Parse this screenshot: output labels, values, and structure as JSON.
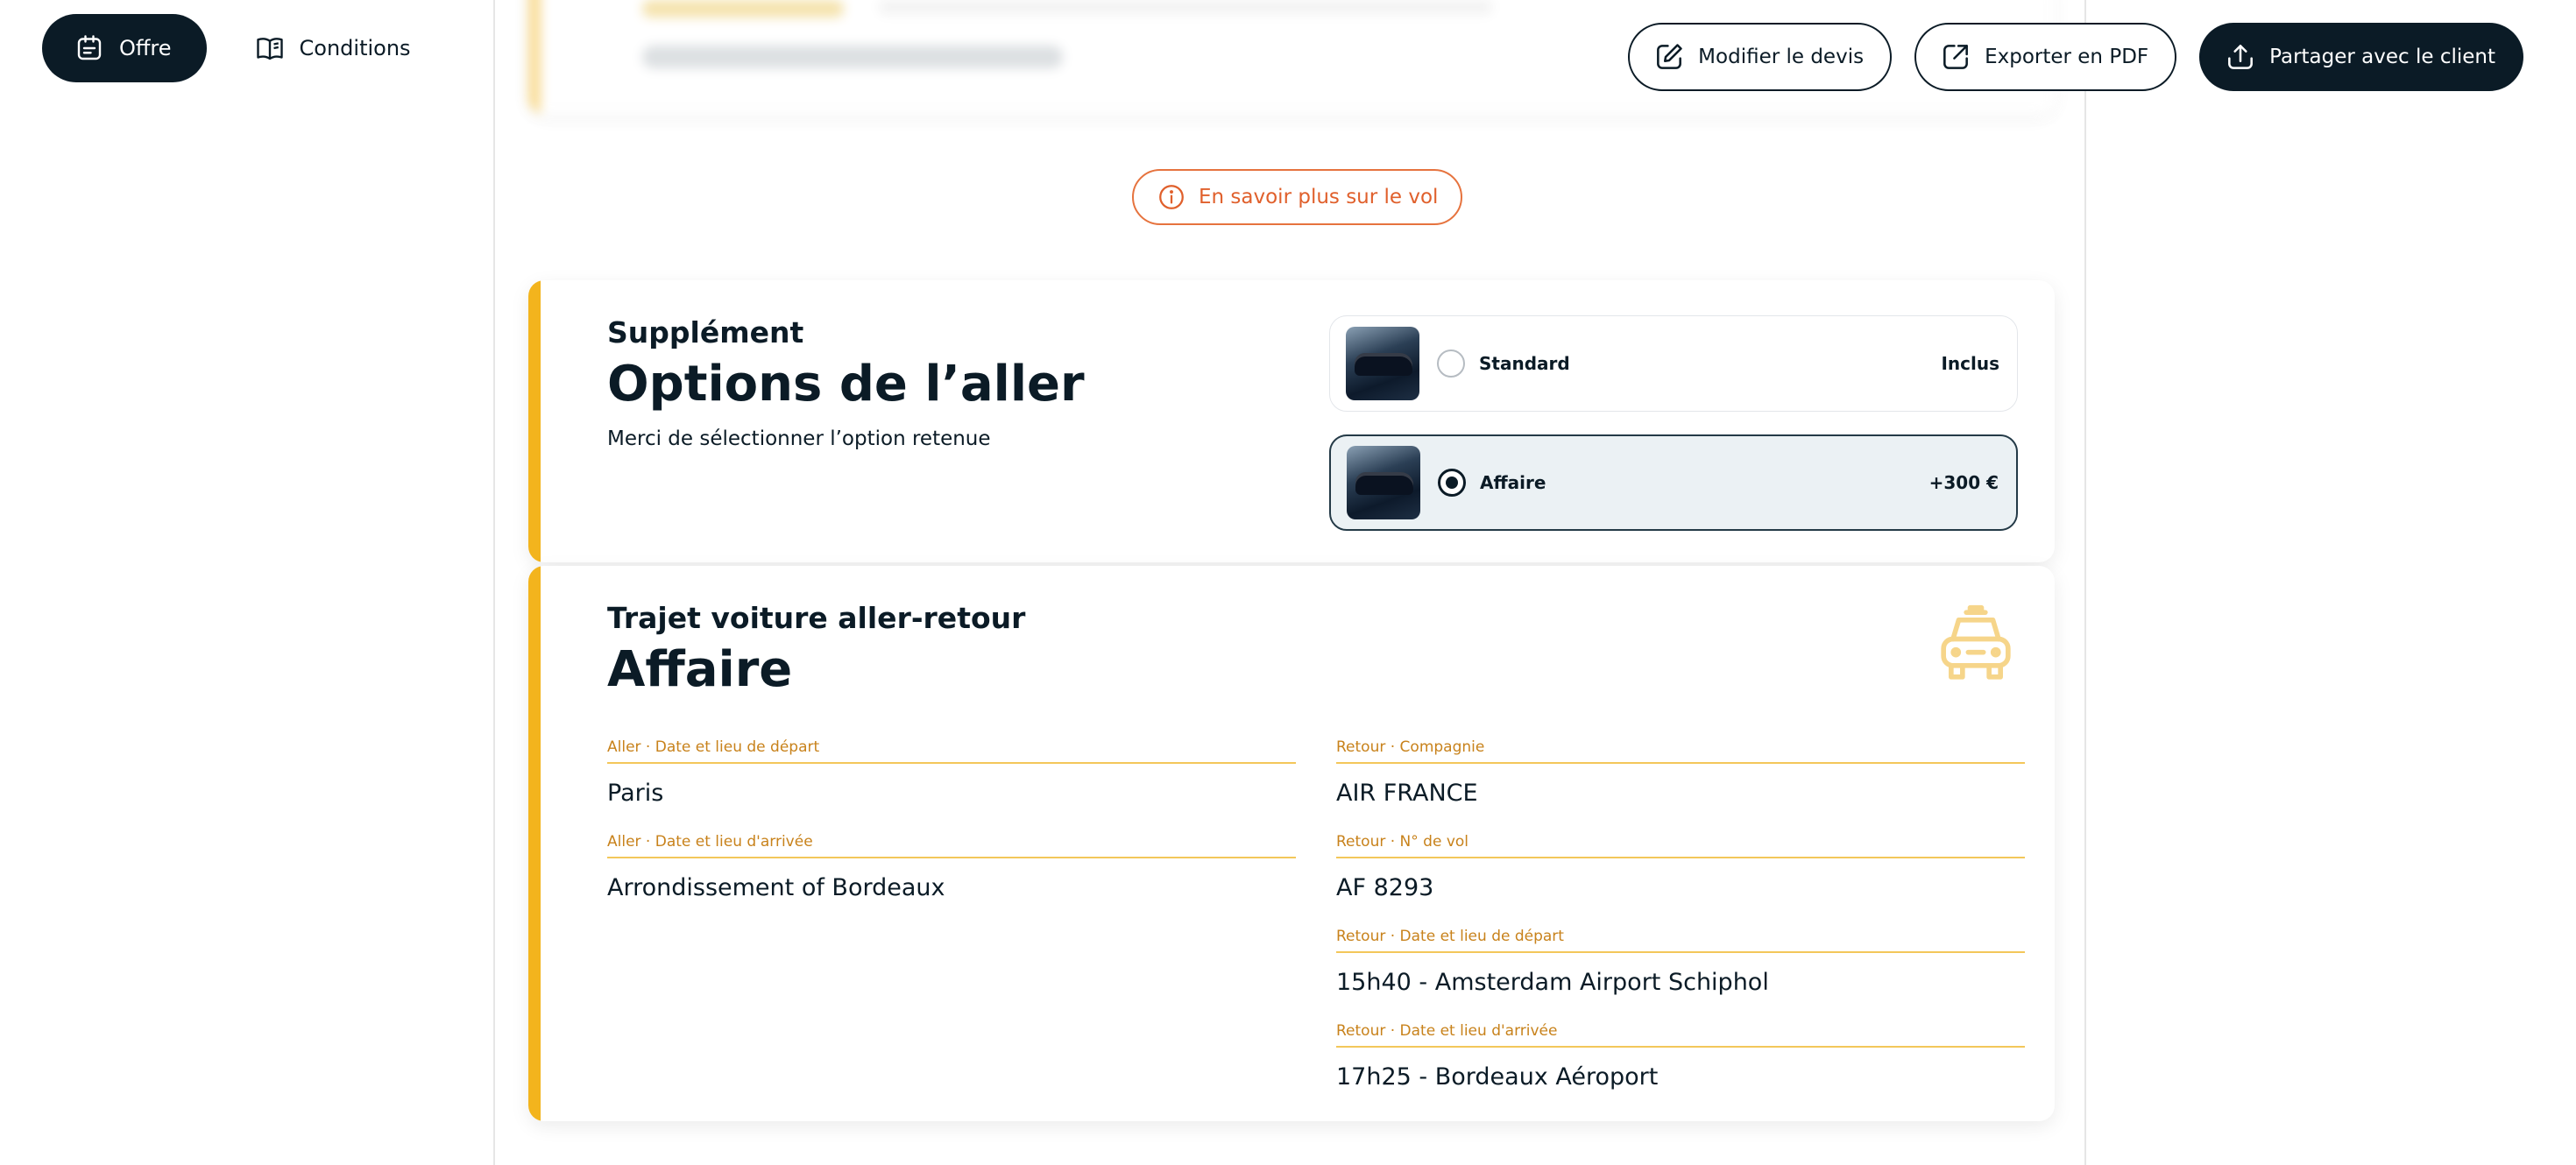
{
  "nav": {
    "tabs": [
      {
        "label": "Offre",
        "icon": "calendar-icon",
        "active": true
      },
      {
        "label": "Conditions",
        "icon": "book-icon",
        "active": false
      }
    ]
  },
  "actions": {
    "edit_label": "Modifier le devis",
    "export_label": "Exporter en PDF",
    "share_label": "Partager avec le client"
  },
  "info_pill": {
    "label": "En savoir plus sur le vol",
    "icon": "info-icon"
  },
  "options_card": {
    "kicker": "Supplément",
    "title": "Options de l’aller",
    "description": "Merci de sélectionner l’option retenue",
    "options": [
      {
        "label": "Standard",
        "price": "Inclus",
        "selected": false
      },
      {
        "label": "Affaire",
        "price": "+300 €",
        "selected": true
      }
    ]
  },
  "trip_card": {
    "kicker": "Trajet voiture aller-retour",
    "title": "Affaire",
    "icon": "car-icon",
    "left_fields": [
      {
        "label": "Aller · Date et lieu de départ",
        "value": "Paris"
      },
      {
        "label": "Aller · Date et lieu d'arrivée",
        "value": "Arrondissement of Bordeaux"
      }
    ],
    "right_fields": [
      {
        "label": "Retour · Compagnie",
        "value": "AIR FRANCE"
      },
      {
        "label": "Retour · N° de vol",
        "value": "AF 8293"
      },
      {
        "label": "Retour · Date et lieu de départ",
        "value": "15h40 - Amsterdam Airport Schiphol"
      },
      {
        "label": "Retour · Date et lieu d'arrivée",
        "value": "17h25 - Bordeaux Aéroport"
      }
    ]
  },
  "colors": {
    "navy": "#0b1b26",
    "accent_yellow": "#f3b41d",
    "label_orange": "#c8821b",
    "info_orange": "#e0602c",
    "selected_bg": "#ebf1f4"
  }
}
